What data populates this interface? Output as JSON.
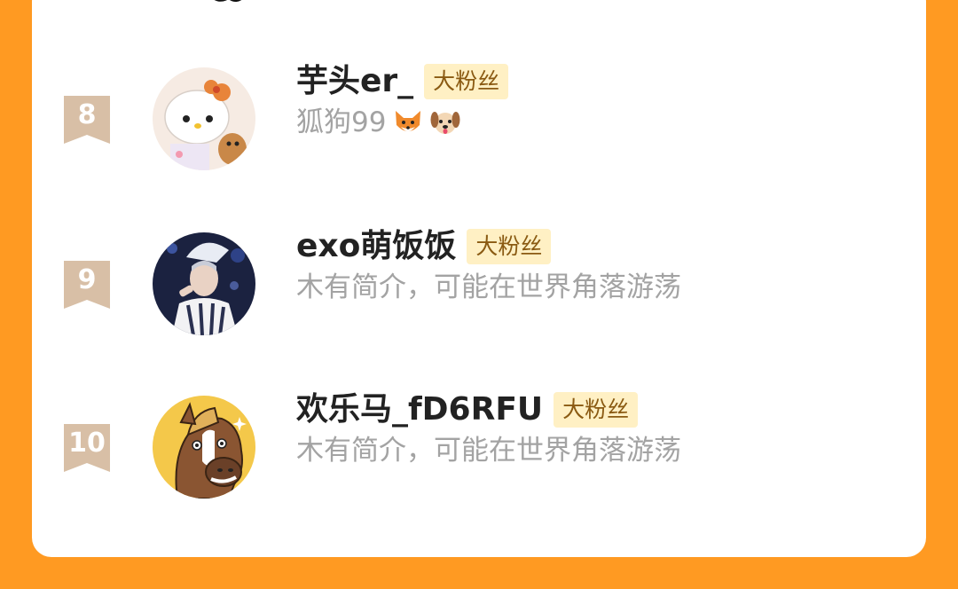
{
  "colors": {
    "background": "#FF9A22",
    "card": "#ffffff",
    "badge_bg": "#FFF0C4",
    "badge_text": "#8A5A12",
    "rank_badge": "#D8BFA6",
    "name_text": "#222222",
    "bio_text": "#A3A3A3"
  },
  "fans": [
    {
      "rank": "8",
      "username": "芋头er_",
      "badge": "大粉丝",
      "bio": "狐狗99",
      "bio_emojis": [
        "fox-emoji-icon",
        "dog-emoji-icon"
      ],
      "avatar": "hello-kitty-avatar"
    },
    {
      "rank": "9",
      "username": "exo萌饭饭",
      "badge": "大粉丝",
      "bio": "木有简介，可能在世界角落游荡",
      "avatar": "performer-photo-avatar"
    },
    {
      "rank": "10",
      "username": "欢乐马_fD6RFU",
      "badge": "大粉丝",
      "bio": "木有简介，可能在世界角落游荡",
      "avatar": "cartoon-horse-avatar"
    }
  ]
}
